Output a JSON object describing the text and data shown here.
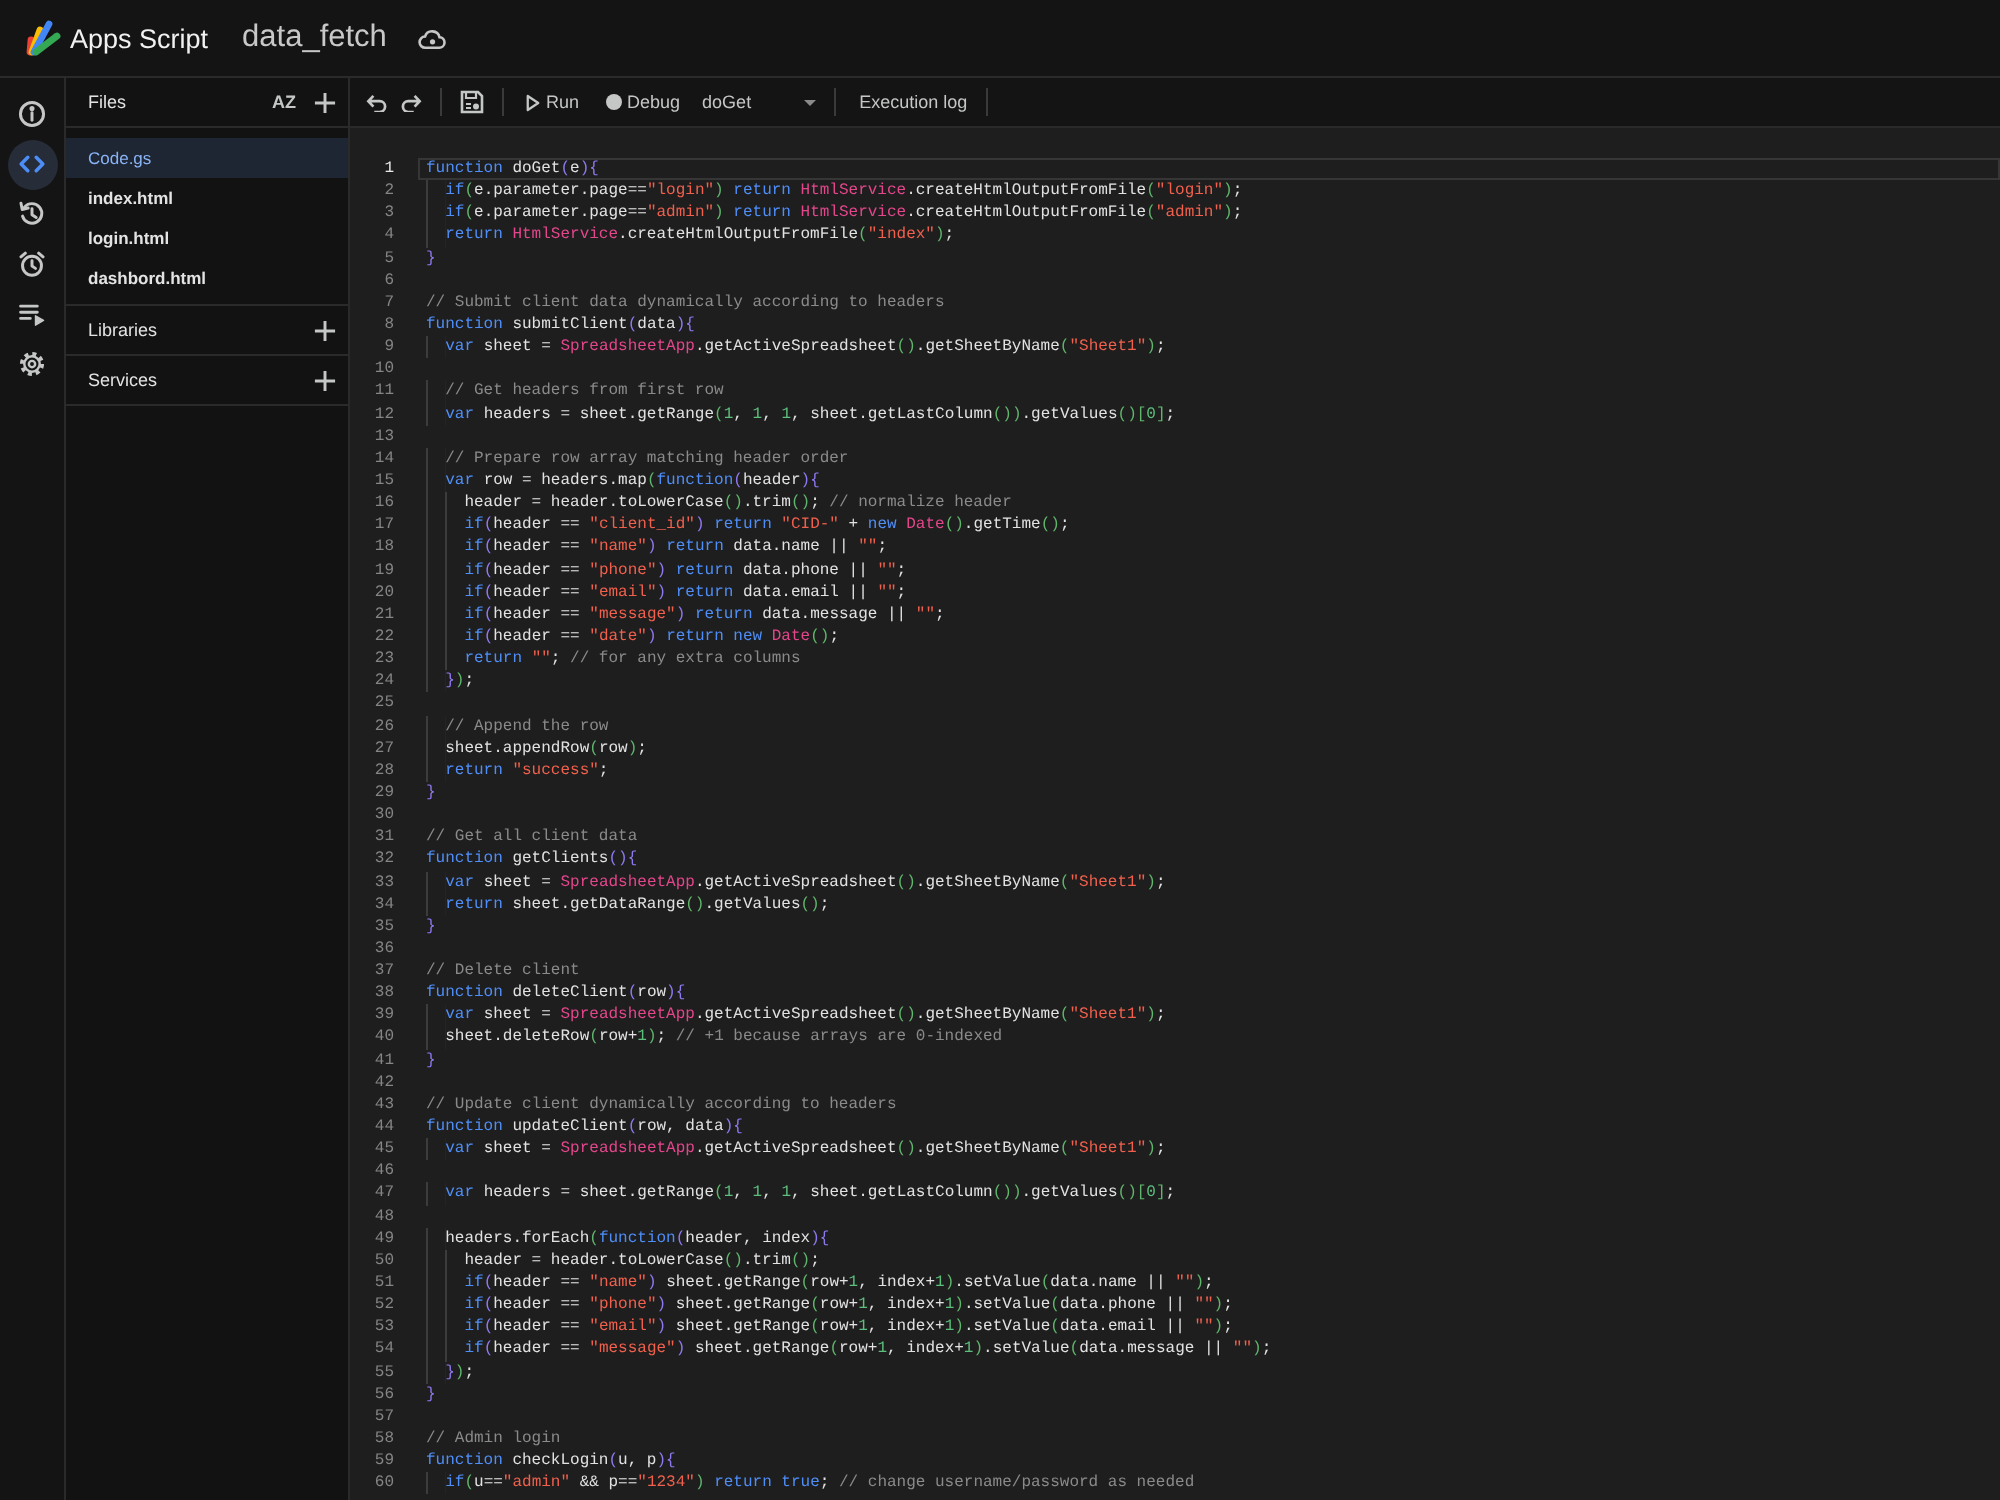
{
  "header": {
    "product": "Apps Script",
    "project": "data_fetch"
  },
  "rail": [
    {
      "kind": "info",
      "selected": false
    },
    {
      "kind": "code",
      "selected": true
    },
    {
      "kind": "history",
      "selected": false
    },
    {
      "kind": "triggers",
      "selected": false
    },
    {
      "kind": "executions",
      "selected": false
    },
    {
      "kind": "settings",
      "selected": false
    }
  ],
  "files": {
    "title": "Files",
    "sort_label": "AZ",
    "items": [
      {
        "name": "Code.gs",
        "selected": true
      },
      {
        "name": "index.html",
        "selected": false
      },
      {
        "name": "login.html",
        "selected": false
      },
      {
        "name": "dashbord.html",
        "selected": false
      }
    ]
  },
  "sections": [
    {
      "title": "Libraries"
    },
    {
      "title": "Services"
    }
  ],
  "toolbar": {
    "run": "Run",
    "debug": "Debug",
    "function": "doGet",
    "log": "Execution log"
  },
  "lines": [
    {
      "number": "1",
      "current": true,
      "tokens": [
        {
          "kind": "keyword",
          "text": "function"
        },
        {
          "kind": "plain",
          "text": " doGet"
        },
        {
          "kind": "brace",
          "text": "("
        },
        {
          "kind": "plain",
          "text": "e"
        },
        {
          "kind": "brace",
          "text": "){"
        }
      ]
    },
    {
      "number": "2",
      "current": false,
      "tokens": [
        {
          "kind": "keyword",
          "text": "  if"
        },
        {
          "kind": "paren",
          "text": "("
        },
        {
          "kind": "plain",
          "text": "e.parameter.page=="
        },
        {
          "kind": "string",
          "text": "\"login\""
        },
        {
          "kind": "paren",
          "text": ")"
        },
        {
          "kind": "keyword",
          "text": " return"
        },
        {
          "kind": "type",
          "text": " HtmlService"
        },
        {
          "kind": "plain",
          "text": ".createHtmlOutputFromFile"
        },
        {
          "kind": "paren",
          "text": "("
        },
        {
          "kind": "string",
          "text": "\"login\""
        },
        {
          "kind": "paren",
          "text": ")"
        },
        {
          "kind": "plain",
          "text": ";"
        }
      ]
    },
    {
      "number": "3",
      "current": false,
      "tokens": [
        {
          "kind": "keyword",
          "text": "  if"
        },
        {
          "kind": "paren",
          "text": "("
        },
        {
          "kind": "plain",
          "text": "e.parameter.page=="
        },
        {
          "kind": "string",
          "text": "\"admin\""
        },
        {
          "kind": "paren",
          "text": ")"
        },
        {
          "kind": "keyword",
          "text": " return"
        },
        {
          "kind": "type",
          "text": " HtmlService"
        },
        {
          "kind": "plain",
          "text": ".createHtmlOutputFromFile"
        },
        {
          "kind": "paren",
          "text": "("
        },
        {
          "kind": "string",
          "text": "\"admin\""
        },
        {
          "kind": "paren",
          "text": ")"
        },
        {
          "kind": "plain",
          "text": ";"
        }
      ]
    },
    {
      "number": "4",
      "current": false,
      "tokens": [
        {
          "kind": "keyword",
          "text": "  return"
        },
        {
          "kind": "type",
          "text": " HtmlService"
        },
        {
          "kind": "plain",
          "text": ".createHtmlOutputFromFile"
        },
        {
          "kind": "paren",
          "text": "("
        },
        {
          "kind": "string",
          "text": "\"index\""
        },
        {
          "kind": "paren",
          "text": ")"
        },
        {
          "kind": "plain",
          "text": ";"
        }
      ]
    },
    {
      "number": "5",
      "current": false,
      "tokens": [
        {
          "kind": "brace",
          "text": "}"
        }
      ]
    },
    {
      "number": "6",
      "current": false
    },
    {
      "number": "7",
      "current": false,
      "tokens": [
        {
          "kind": "comment",
          "text": "// Submit client data dynamically according to headers"
        }
      ]
    },
    {
      "number": "8",
      "current": false,
      "tokens": [
        {
          "kind": "keyword",
          "text": "function"
        },
        {
          "kind": "plain",
          "text": " submitClient"
        },
        {
          "kind": "brace",
          "text": "("
        },
        {
          "kind": "plain",
          "text": "data"
        },
        {
          "kind": "brace",
          "text": "){"
        }
      ]
    },
    {
      "number": "9",
      "current": false,
      "tokens": [
        {
          "kind": "keyword",
          "text": "  var"
        },
        {
          "kind": "plain",
          "text": " sheet = "
        },
        {
          "kind": "type",
          "text": "SpreadsheetApp"
        },
        {
          "kind": "plain",
          "text": ".getActiveSpreadsheet"
        },
        {
          "kind": "paren",
          "text": "()"
        },
        {
          "kind": "plain",
          "text": ".getSheetByName"
        },
        {
          "kind": "paren",
          "text": "("
        },
        {
          "kind": "string",
          "text": "\"Sheet1\""
        },
        {
          "kind": "paren",
          "text": ")"
        },
        {
          "kind": "plain",
          "text": ";"
        }
      ]
    },
    {
      "number": "10",
      "current": false
    },
    {
      "number": "11",
      "current": false,
      "tokens": [
        {
          "kind": "comment",
          "text": "  // Get headers from first row"
        }
      ]
    },
    {
      "number": "12",
      "current": false,
      "tokens": [
        {
          "kind": "keyword",
          "text": "  var"
        },
        {
          "kind": "plain",
          "text": " headers = sheet.getRange"
        },
        {
          "kind": "paren",
          "text": "("
        },
        {
          "kind": "number",
          "text": "1"
        },
        {
          "kind": "plain",
          "text": ", "
        },
        {
          "kind": "number",
          "text": "1"
        },
        {
          "kind": "plain",
          "text": ", "
        },
        {
          "kind": "number",
          "text": "1"
        },
        {
          "kind": "plain",
          "text": ", sheet.getLastColumn"
        },
        {
          "kind": "paren",
          "text": "())"
        },
        {
          "kind": "plain",
          "text": ".getValues"
        },
        {
          "kind": "paren",
          "text": "()["
        },
        {
          "kind": "number",
          "text": "0"
        },
        {
          "kind": "paren",
          "text": "]"
        },
        {
          "kind": "plain",
          "text": ";"
        }
      ]
    },
    {
      "number": "13",
      "current": false
    },
    {
      "number": "14",
      "current": false,
      "tokens": [
        {
          "kind": "comment",
          "text": "  // Prepare row array matching header order"
        }
      ]
    },
    {
      "number": "15",
      "current": false,
      "tokens": [
        {
          "kind": "keyword",
          "text": "  var"
        },
        {
          "kind": "plain",
          "text": " row = headers.map"
        },
        {
          "kind": "paren",
          "text": "("
        },
        {
          "kind": "keyword",
          "text": "function"
        },
        {
          "kind": "brace",
          "text": "("
        },
        {
          "kind": "plain",
          "text": "header"
        },
        {
          "kind": "brace",
          "text": "){"
        }
      ]
    },
    {
      "number": "16",
      "current": false,
      "tokens": [
        {
          "kind": "plain",
          "text": "    header = header.toLowerCase"
        },
        {
          "kind": "paren",
          "text": "()"
        },
        {
          "kind": "plain",
          "text": ".trim"
        },
        {
          "kind": "paren",
          "text": "()"
        },
        {
          "kind": "plain",
          "text": "; "
        },
        {
          "kind": "comment",
          "text": "// normalize header"
        }
      ]
    },
    {
      "number": "17",
      "current": false,
      "tokens": [
        {
          "kind": "keyword",
          "text": "    if"
        },
        {
          "kind": "brace",
          "text": "("
        },
        {
          "kind": "plain",
          "text": "header == "
        },
        {
          "kind": "string",
          "text": "\"client_id\""
        },
        {
          "kind": "brace",
          "text": ")"
        },
        {
          "kind": "keyword",
          "text": " return"
        },
        {
          "kind": "string",
          "text": " \"CID-\""
        },
        {
          "kind": "plain",
          "text": " + "
        },
        {
          "kind": "keyword",
          "text": "new"
        },
        {
          "kind": "type",
          "text": " Date"
        },
        {
          "kind": "paren",
          "text": "()"
        },
        {
          "kind": "plain",
          "text": ".getTime"
        },
        {
          "kind": "paren",
          "text": "()"
        },
        {
          "kind": "plain",
          "text": ";"
        }
      ]
    },
    {
      "number": "18",
      "current": false,
      "tokens": [
        {
          "kind": "keyword",
          "text": "    if"
        },
        {
          "kind": "brace",
          "text": "("
        },
        {
          "kind": "plain",
          "text": "header == "
        },
        {
          "kind": "string",
          "text": "\"name\""
        },
        {
          "kind": "brace",
          "text": ")"
        },
        {
          "kind": "keyword",
          "text": " return"
        },
        {
          "kind": "plain",
          "text": " data.name || "
        },
        {
          "kind": "string",
          "text": "\"\""
        },
        {
          "kind": "plain",
          "text": ";"
        }
      ]
    },
    {
      "number": "19",
      "current": false,
      "tokens": [
        {
          "kind": "keyword",
          "text": "    if"
        },
        {
          "kind": "brace",
          "text": "("
        },
        {
          "kind": "plain",
          "text": "header == "
        },
        {
          "kind": "string",
          "text": "\"phone\""
        },
        {
          "kind": "brace",
          "text": ")"
        },
        {
          "kind": "keyword",
          "text": " return"
        },
        {
          "kind": "plain",
          "text": " data.phone || "
        },
        {
          "kind": "string",
          "text": "\"\""
        },
        {
          "kind": "plain",
          "text": ";"
        }
      ]
    },
    {
      "number": "20",
      "current": false,
      "tokens": [
        {
          "kind": "keyword",
          "text": "    if"
        },
        {
          "kind": "brace",
          "text": "("
        },
        {
          "kind": "plain",
          "text": "header == "
        },
        {
          "kind": "string",
          "text": "\"email\""
        },
        {
          "kind": "brace",
          "text": ")"
        },
        {
          "kind": "keyword",
          "text": " return"
        },
        {
          "kind": "plain",
          "text": " data.email || "
        },
        {
          "kind": "string",
          "text": "\"\""
        },
        {
          "kind": "plain",
          "text": ";"
        }
      ]
    },
    {
      "number": "21",
      "current": false,
      "tokens": [
        {
          "kind": "keyword",
          "text": "    if"
        },
        {
          "kind": "brace",
          "text": "("
        },
        {
          "kind": "plain",
          "text": "header == "
        },
        {
          "kind": "string",
          "text": "\"message\""
        },
        {
          "kind": "brace",
          "text": ")"
        },
        {
          "kind": "keyword",
          "text": " return"
        },
        {
          "kind": "plain",
          "text": " data.message || "
        },
        {
          "kind": "string",
          "text": "\"\""
        },
        {
          "kind": "plain",
          "text": ";"
        }
      ]
    },
    {
      "number": "22",
      "current": false,
      "tokens": [
        {
          "kind": "keyword",
          "text": "    if"
        },
        {
          "kind": "brace",
          "text": "("
        },
        {
          "kind": "plain",
          "text": "header == "
        },
        {
          "kind": "string",
          "text": "\"date\""
        },
        {
          "kind": "brace",
          "text": ")"
        },
        {
          "kind": "keyword",
          "text": " return new"
        },
        {
          "kind": "type",
          "text": " Date"
        },
        {
          "kind": "paren",
          "text": "()"
        },
        {
          "kind": "plain",
          "text": ";"
        }
      ]
    },
    {
      "number": "23",
      "current": false,
      "tokens": [
        {
          "kind": "keyword",
          "text": "    return"
        },
        {
          "kind": "string",
          "text": " \"\""
        },
        {
          "kind": "plain",
          "text": "; "
        },
        {
          "kind": "comment",
          "text": "// for any extra columns"
        }
      ]
    },
    {
      "number": "24",
      "current": false,
      "tokens": [
        {
          "kind": "brace",
          "text": "  }"
        },
        {
          "kind": "paren",
          "text": ")"
        },
        {
          "kind": "plain",
          "text": ";"
        }
      ]
    },
    {
      "number": "25",
      "current": false
    },
    {
      "number": "26",
      "current": false,
      "tokens": [
        {
          "kind": "comment",
          "text": "  // Append the row"
        }
      ]
    },
    {
      "number": "27",
      "current": false,
      "tokens": [
        {
          "kind": "plain",
          "text": "  sheet.appendRow"
        },
        {
          "kind": "paren",
          "text": "("
        },
        {
          "kind": "plain",
          "text": "row"
        },
        {
          "kind": "paren",
          "text": ")"
        },
        {
          "kind": "plain",
          "text": ";"
        }
      ]
    },
    {
      "number": "28",
      "current": false,
      "tokens": [
        {
          "kind": "keyword",
          "text": "  return"
        },
        {
          "kind": "string",
          "text": " \"success\""
        },
        {
          "kind": "plain",
          "text": ";"
        }
      ]
    },
    {
      "number": "29",
      "current": false,
      "tokens": [
        {
          "kind": "brace",
          "text": "}"
        }
      ]
    },
    {
      "number": "30",
      "current": false
    },
    {
      "number": "31",
      "current": false,
      "tokens": [
        {
          "kind": "comment",
          "text": "// Get all client data"
        }
      ]
    },
    {
      "number": "32",
      "current": false,
      "tokens": [
        {
          "kind": "keyword",
          "text": "function"
        },
        {
          "kind": "plain",
          "text": " getClients"
        },
        {
          "kind": "brace",
          "text": "(){"
        }
      ]
    },
    {
      "number": "33",
      "current": false,
      "tokens": [
        {
          "kind": "keyword",
          "text": "  var"
        },
        {
          "kind": "plain",
          "text": " sheet = "
        },
        {
          "kind": "type",
          "text": "SpreadsheetApp"
        },
        {
          "kind": "plain",
          "text": ".getActiveSpreadsheet"
        },
        {
          "kind": "paren",
          "text": "()"
        },
        {
          "kind": "plain",
          "text": ".getSheetByName"
        },
        {
          "kind": "paren",
          "text": "("
        },
        {
          "kind": "string",
          "text": "\"Sheet1\""
        },
        {
          "kind": "paren",
          "text": ")"
        },
        {
          "kind": "plain",
          "text": ";"
        }
      ]
    },
    {
      "number": "34",
      "current": false,
      "tokens": [
        {
          "kind": "keyword",
          "text": "  return"
        },
        {
          "kind": "plain",
          "text": " sheet.getDataRange"
        },
        {
          "kind": "paren",
          "text": "()"
        },
        {
          "kind": "plain",
          "text": ".getValues"
        },
        {
          "kind": "paren",
          "text": "()"
        },
        {
          "kind": "plain",
          "text": ";"
        }
      ]
    },
    {
      "number": "35",
      "current": false,
      "tokens": [
        {
          "kind": "brace",
          "text": "}"
        }
      ]
    },
    {
      "number": "36",
      "current": false
    },
    {
      "number": "37",
      "current": false,
      "tokens": [
        {
          "kind": "comment",
          "text": "// Delete client"
        }
      ]
    },
    {
      "number": "38",
      "current": false,
      "tokens": [
        {
          "kind": "keyword",
          "text": "function"
        },
        {
          "kind": "plain",
          "text": " deleteClient"
        },
        {
          "kind": "brace",
          "text": "("
        },
        {
          "kind": "plain",
          "text": "row"
        },
        {
          "kind": "brace",
          "text": "){"
        }
      ]
    },
    {
      "number": "39",
      "current": false,
      "tokens": [
        {
          "kind": "keyword",
          "text": "  var"
        },
        {
          "kind": "plain",
          "text": " sheet = "
        },
        {
          "kind": "type",
          "text": "SpreadsheetApp"
        },
        {
          "kind": "plain",
          "text": ".getActiveSpreadsheet"
        },
        {
          "kind": "paren",
          "text": "()"
        },
        {
          "kind": "plain",
          "text": ".getSheetByName"
        },
        {
          "kind": "paren",
          "text": "("
        },
        {
          "kind": "string",
          "text": "\"Sheet1\""
        },
        {
          "kind": "paren",
          "text": ")"
        },
        {
          "kind": "plain",
          "text": ";"
        }
      ]
    },
    {
      "number": "40",
      "current": false,
      "tokens": [
        {
          "kind": "plain",
          "text": "  sheet.deleteRow"
        },
        {
          "kind": "paren",
          "text": "("
        },
        {
          "kind": "plain",
          "text": "row+"
        },
        {
          "kind": "number",
          "text": "1"
        },
        {
          "kind": "paren",
          "text": ")"
        },
        {
          "kind": "plain",
          "text": "; "
        },
        {
          "kind": "comment",
          "text": "// +1 because arrays are 0-indexed"
        }
      ]
    },
    {
      "number": "41",
      "current": false,
      "tokens": [
        {
          "kind": "brace",
          "text": "}"
        }
      ]
    },
    {
      "number": "42",
      "current": false
    },
    {
      "number": "43",
      "current": false,
      "tokens": [
        {
          "kind": "comment",
          "text": "// Update client dynamically according to headers"
        }
      ]
    },
    {
      "number": "44",
      "current": false,
      "tokens": [
        {
          "kind": "keyword",
          "text": "function"
        },
        {
          "kind": "plain",
          "text": " updateClient"
        },
        {
          "kind": "brace",
          "text": "("
        },
        {
          "kind": "plain",
          "text": "row, data"
        },
        {
          "kind": "brace",
          "text": "){"
        }
      ]
    },
    {
      "number": "45",
      "current": false,
      "tokens": [
        {
          "kind": "keyword",
          "text": "  var"
        },
        {
          "kind": "plain",
          "text": " sheet = "
        },
        {
          "kind": "type",
          "text": "SpreadsheetApp"
        },
        {
          "kind": "plain",
          "text": ".getActiveSpreadsheet"
        },
        {
          "kind": "paren",
          "text": "()"
        },
        {
          "kind": "plain",
          "text": ".getSheetByName"
        },
        {
          "kind": "paren",
          "text": "("
        },
        {
          "kind": "string",
          "text": "\"Sheet1\""
        },
        {
          "kind": "paren",
          "text": ")"
        },
        {
          "kind": "plain",
          "text": ";"
        }
      ]
    },
    {
      "number": "46",
      "current": false
    },
    {
      "number": "47",
      "current": false,
      "tokens": [
        {
          "kind": "keyword",
          "text": "  var"
        },
        {
          "kind": "plain",
          "text": " headers = sheet.getRange"
        },
        {
          "kind": "paren",
          "text": "("
        },
        {
          "kind": "number",
          "text": "1"
        },
        {
          "kind": "plain",
          "text": ", "
        },
        {
          "kind": "number",
          "text": "1"
        },
        {
          "kind": "plain",
          "text": ", "
        },
        {
          "kind": "number",
          "text": "1"
        },
        {
          "kind": "plain",
          "text": ", sheet.getLastColumn"
        },
        {
          "kind": "paren",
          "text": "())"
        },
        {
          "kind": "plain",
          "text": ".getValues"
        },
        {
          "kind": "paren",
          "text": "()["
        },
        {
          "kind": "number",
          "text": "0"
        },
        {
          "kind": "paren",
          "text": "]"
        },
        {
          "kind": "plain",
          "text": ";"
        }
      ]
    },
    {
      "number": "48",
      "current": false
    },
    {
      "number": "49",
      "current": false,
      "tokens": [
        {
          "kind": "plain",
          "text": "  headers.forEach"
        },
        {
          "kind": "paren",
          "text": "("
        },
        {
          "kind": "keyword",
          "text": "function"
        },
        {
          "kind": "brace",
          "text": "("
        },
        {
          "kind": "plain",
          "text": "header, index"
        },
        {
          "kind": "brace",
          "text": "){"
        }
      ]
    },
    {
      "number": "50",
      "current": false,
      "tokens": [
        {
          "kind": "plain",
          "text": "    header = header.toLowerCase"
        },
        {
          "kind": "paren",
          "text": "()"
        },
        {
          "kind": "plain",
          "text": ".trim"
        },
        {
          "kind": "paren",
          "text": "()"
        },
        {
          "kind": "plain",
          "text": ";"
        }
      ]
    },
    {
      "number": "51",
      "current": false,
      "tokens": [
        {
          "kind": "keyword",
          "text": "    if"
        },
        {
          "kind": "brace",
          "text": "("
        },
        {
          "kind": "plain",
          "text": "header == "
        },
        {
          "kind": "string",
          "text": "\"name\""
        },
        {
          "kind": "brace",
          "text": ")"
        },
        {
          "kind": "plain",
          "text": " sheet.getRange"
        },
        {
          "kind": "paren",
          "text": "("
        },
        {
          "kind": "plain",
          "text": "row+"
        },
        {
          "kind": "number",
          "text": "1"
        },
        {
          "kind": "plain",
          "text": ", index+"
        },
        {
          "kind": "number",
          "text": "1"
        },
        {
          "kind": "paren",
          "text": ")"
        },
        {
          "kind": "plain",
          "text": ".setValue"
        },
        {
          "kind": "paren",
          "text": "("
        },
        {
          "kind": "plain",
          "text": "data.name || "
        },
        {
          "kind": "string",
          "text": "\"\""
        },
        {
          "kind": "paren",
          "text": ")"
        },
        {
          "kind": "plain",
          "text": ";"
        }
      ]
    },
    {
      "number": "52",
      "current": false,
      "tokens": [
        {
          "kind": "keyword",
          "text": "    if"
        },
        {
          "kind": "brace",
          "text": "("
        },
        {
          "kind": "plain",
          "text": "header == "
        },
        {
          "kind": "string",
          "text": "\"phone\""
        },
        {
          "kind": "brace",
          "text": ")"
        },
        {
          "kind": "plain",
          "text": " sheet.getRange"
        },
        {
          "kind": "paren",
          "text": "("
        },
        {
          "kind": "plain",
          "text": "row+"
        },
        {
          "kind": "number",
          "text": "1"
        },
        {
          "kind": "plain",
          "text": ", index+"
        },
        {
          "kind": "number",
          "text": "1"
        },
        {
          "kind": "paren",
          "text": ")"
        },
        {
          "kind": "plain",
          "text": ".setValue"
        },
        {
          "kind": "paren",
          "text": "("
        },
        {
          "kind": "plain",
          "text": "data.phone || "
        },
        {
          "kind": "string",
          "text": "\"\""
        },
        {
          "kind": "paren",
          "text": ")"
        },
        {
          "kind": "plain",
          "text": ";"
        }
      ]
    },
    {
      "number": "53",
      "current": false,
      "tokens": [
        {
          "kind": "keyword",
          "text": "    if"
        },
        {
          "kind": "brace",
          "text": "("
        },
        {
          "kind": "plain",
          "text": "header == "
        },
        {
          "kind": "string",
          "text": "\"email\""
        },
        {
          "kind": "brace",
          "text": ")"
        },
        {
          "kind": "plain",
          "text": " sheet.getRange"
        },
        {
          "kind": "paren",
          "text": "("
        },
        {
          "kind": "plain",
          "text": "row+"
        },
        {
          "kind": "number",
          "text": "1"
        },
        {
          "kind": "plain",
          "text": ", index+"
        },
        {
          "kind": "number",
          "text": "1"
        },
        {
          "kind": "paren",
          "text": ")"
        },
        {
          "kind": "plain",
          "text": ".setValue"
        },
        {
          "kind": "paren",
          "text": "("
        },
        {
          "kind": "plain",
          "text": "data.email || "
        },
        {
          "kind": "string",
          "text": "\"\""
        },
        {
          "kind": "paren",
          "text": ")"
        },
        {
          "kind": "plain",
          "text": ";"
        }
      ]
    },
    {
      "number": "54",
      "current": false,
      "tokens": [
        {
          "kind": "keyword",
          "text": "    if"
        },
        {
          "kind": "brace",
          "text": "("
        },
        {
          "kind": "plain",
          "text": "header == "
        },
        {
          "kind": "string",
          "text": "\"message\""
        },
        {
          "kind": "brace",
          "text": ")"
        },
        {
          "kind": "plain",
          "text": " sheet.getRange"
        },
        {
          "kind": "paren",
          "text": "("
        },
        {
          "kind": "plain",
          "text": "row+"
        },
        {
          "kind": "number",
          "text": "1"
        },
        {
          "kind": "plain",
          "text": ", index+"
        },
        {
          "kind": "number",
          "text": "1"
        },
        {
          "kind": "paren",
          "text": ")"
        },
        {
          "kind": "plain",
          "text": ".setValue"
        },
        {
          "kind": "paren",
          "text": "("
        },
        {
          "kind": "plain",
          "text": "data.message || "
        },
        {
          "kind": "string",
          "text": "\"\""
        },
        {
          "kind": "paren",
          "text": ")"
        },
        {
          "kind": "plain",
          "text": ";"
        }
      ]
    },
    {
      "number": "55",
      "current": false,
      "tokens": [
        {
          "kind": "brace",
          "text": "  }"
        },
        {
          "kind": "paren",
          "text": ")"
        },
        {
          "kind": "plain",
          "text": ";"
        }
      ]
    },
    {
      "number": "56",
      "current": false,
      "tokens": [
        {
          "kind": "brace",
          "text": "}"
        }
      ]
    },
    {
      "number": "57",
      "current": false
    },
    {
      "number": "58",
      "current": false,
      "tokens": [
        {
          "kind": "comment",
          "text": "// Admin login"
        }
      ]
    },
    {
      "number": "59",
      "current": false,
      "tokens": [
        {
          "kind": "keyword",
          "text": "function"
        },
        {
          "kind": "plain",
          "text": " checkLogin"
        },
        {
          "kind": "brace",
          "text": "("
        },
        {
          "kind": "plain",
          "text": "u, p"
        },
        {
          "kind": "brace",
          "text": "){"
        }
      ]
    },
    {
      "number": "60",
      "current": false,
      "tokens": [
        {
          "kind": "keyword",
          "text": "  if"
        },
        {
          "kind": "paren",
          "text": "("
        },
        {
          "kind": "plain",
          "text": "u=="
        },
        {
          "kind": "string",
          "text": "\"admin\""
        },
        {
          "kind": "plain",
          "text": " && p=="
        },
        {
          "kind": "string",
          "text": "\"1234\""
        },
        {
          "kind": "paren",
          "text": ")"
        },
        {
          "kind": "keyword",
          "text": " return true"
        },
        {
          "kind": "plain",
          "text": "; "
        },
        {
          "kind": "comment",
          "text": "// change username/password as needed"
        }
      ]
    }
  ]
}
